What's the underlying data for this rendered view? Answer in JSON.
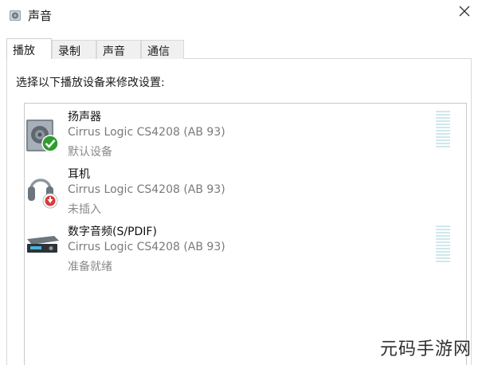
{
  "window": {
    "title": "声音",
    "title_icon": "speaker-icon",
    "close_icon": "close-icon"
  },
  "tabs": [
    {
      "label": "播放",
      "active": true
    },
    {
      "label": "录制",
      "active": false
    },
    {
      "label": "声音",
      "active": false
    },
    {
      "label": "通信",
      "active": false
    }
  ],
  "playback": {
    "instruction": "选择以下播放设备来修改设置:",
    "devices": [
      {
        "name": "扬声器",
        "driver": "Cirrus Logic CS4208 (AB 93)",
        "status": "默认设备",
        "icon": "speaker-device-icon",
        "badge": "green-check-icon",
        "level_meter": true
      },
      {
        "name": "耳机",
        "driver": "Cirrus Logic CS4208 (AB 93)",
        "status": "未插入",
        "icon": "headphones-icon",
        "badge": "red-down-arrow-icon",
        "level_meter": false
      },
      {
        "name": "数字音频(S/PDIF)",
        "driver": "Cirrus Logic CS4208 (AB 93)",
        "status": "准备就绪",
        "icon": "digital-audio-icon",
        "badge": "",
        "level_meter": true
      }
    ]
  },
  "watermark": "元码手游网",
  "colors": {
    "meter": "#cfe8ec",
    "check_badge": "#2e9d2e",
    "unplugged_badge": "#d83b3b"
  }
}
